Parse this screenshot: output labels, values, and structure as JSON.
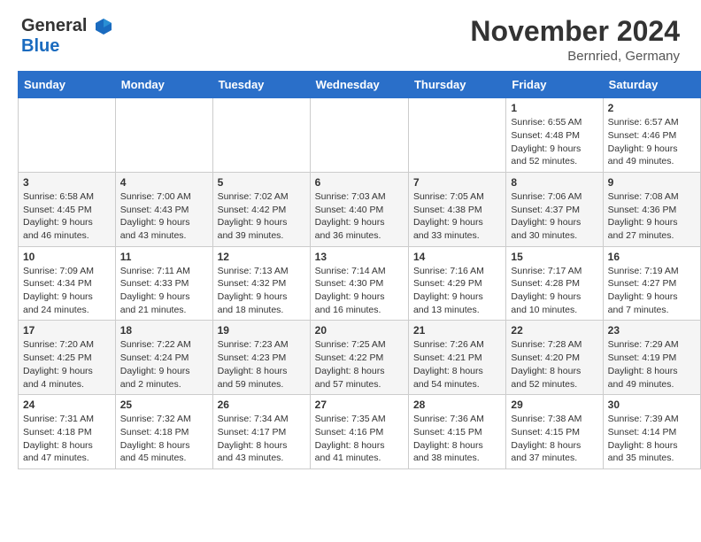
{
  "header": {
    "logo_line1": "General",
    "logo_line2": "Blue",
    "month_year": "November 2024",
    "location": "Bernried, Germany"
  },
  "days": [
    "Sunday",
    "Monday",
    "Tuesday",
    "Wednesday",
    "Thursday",
    "Friday",
    "Saturday"
  ],
  "weeks": [
    [
      {
        "date": "",
        "info": ""
      },
      {
        "date": "",
        "info": ""
      },
      {
        "date": "",
        "info": ""
      },
      {
        "date": "",
        "info": ""
      },
      {
        "date": "",
        "info": ""
      },
      {
        "date": "1",
        "info": "Sunrise: 6:55 AM\nSunset: 4:48 PM\nDaylight: 9 hours\nand 52 minutes."
      },
      {
        "date": "2",
        "info": "Sunrise: 6:57 AM\nSunset: 4:46 PM\nDaylight: 9 hours\nand 49 minutes."
      }
    ],
    [
      {
        "date": "3",
        "info": "Sunrise: 6:58 AM\nSunset: 4:45 PM\nDaylight: 9 hours\nand 46 minutes."
      },
      {
        "date": "4",
        "info": "Sunrise: 7:00 AM\nSunset: 4:43 PM\nDaylight: 9 hours\nand 43 minutes."
      },
      {
        "date": "5",
        "info": "Sunrise: 7:02 AM\nSunset: 4:42 PM\nDaylight: 9 hours\nand 39 minutes."
      },
      {
        "date": "6",
        "info": "Sunrise: 7:03 AM\nSunset: 4:40 PM\nDaylight: 9 hours\nand 36 minutes."
      },
      {
        "date": "7",
        "info": "Sunrise: 7:05 AM\nSunset: 4:38 PM\nDaylight: 9 hours\nand 33 minutes."
      },
      {
        "date": "8",
        "info": "Sunrise: 7:06 AM\nSunset: 4:37 PM\nDaylight: 9 hours\nand 30 minutes."
      },
      {
        "date": "9",
        "info": "Sunrise: 7:08 AM\nSunset: 4:36 PM\nDaylight: 9 hours\nand 27 minutes."
      }
    ],
    [
      {
        "date": "10",
        "info": "Sunrise: 7:09 AM\nSunset: 4:34 PM\nDaylight: 9 hours\nand 24 minutes."
      },
      {
        "date": "11",
        "info": "Sunrise: 7:11 AM\nSunset: 4:33 PM\nDaylight: 9 hours\nand 21 minutes."
      },
      {
        "date": "12",
        "info": "Sunrise: 7:13 AM\nSunset: 4:32 PM\nDaylight: 9 hours\nand 18 minutes."
      },
      {
        "date": "13",
        "info": "Sunrise: 7:14 AM\nSunset: 4:30 PM\nDaylight: 9 hours\nand 16 minutes."
      },
      {
        "date": "14",
        "info": "Sunrise: 7:16 AM\nSunset: 4:29 PM\nDaylight: 9 hours\nand 13 minutes."
      },
      {
        "date": "15",
        "info": "Sunrise: 7:17 AM\nSunset: 4:28 PM\nDaylight: 9 hours\nand 10 minutes."
      },
      {
        "date": "16",
        "info": "Sunrise: 7:19 AM\nSunset: 4:27 PM\nDaylight: 9 hours\nand 7 minutes."
      }
    ],
    [
      {
        "date": "17",
        "info": "Sunrise: 7:20 AM\nSunset: 4:25 PM\nDaylight: 9 hours\nand 4 minutes."
      },
      {
        "date": "18",
        "info": "Sunrise: 7:22 AM\nSunset: 4:24 PM\nDaylight: 9 hours\nand 2 minutes."
      },
      {
        "date": "19",
        "info": "Sunrise: 7:23 AM\nSunset: 4:23 PM\nDaylight: 8 hours\nand 59 minutes."
      },
      {
        "date": "20",
        "info": "Sunrise: 7:25 AM\nSunset: 4:22 PM\nDaylight: 8 hours\nand 57 minutes."
      },
      {
        "date": "21",
        "info": "Sunrise: 7:26 AM\nSunset: 4:21 PM\nDaylight: 8 hours\nand 54 minutes."
      },
      {
        "date": "22",
        "info": "Sunrise: 7:28 AM\nSunset: 4:20 PM\nDaylight: 8 hours\nand 52 minutes."
      },
      {
        "date": "23",
        "info": "Sunrise: 7:29 AM\nSunset: 4:19 PM\nDaylight: 8 hours\nand 49 minutes."
      }
    ],
    [
      {
        "date": "24",
        "info": "Sunrise: 7:31 AM\nSunset: 4:18 PM\nDaylight: 8 hours\nand 47 minutes."
      },
      {
        "date": "25",
        "info": "Sunrise: 7:32 AM\nSunset: 4:18 PM\nDaylight: 8 hours\nand 45 minutes."
      },
      {
        "date": "26",
        "info": "Sunrise: 7:34 AM\nSunset: 4:17 PM\nDaylight: 8 hours\nand 43 minutes."
      },
      {
        "date": "27",
        "info": "Sunrise: 7:35 AM\nSunset: 4:16 PM\nDaylight: 8 hours\nand 41 minutes."
      },
      {
        "date": "28",
        "info": "Sunrise: 7:36 AM\nSunset: 4:15 PM\nDaylight: 8 hours\nand 38 minutes."
      },
      {
        "date": "29",
        "info": "Sunrise: 7:38 AM\nSunset: 4:15 PM\nDaylight: 8 hours\nand 37 minutes."
      },
      {
        "date": "30",
        "info": "Sunrise: 7:39 AM\nSunset: 4:14 PM\nDaylight: 8 hours\nand 35 minutes."
      }
    ]
  ]
}
